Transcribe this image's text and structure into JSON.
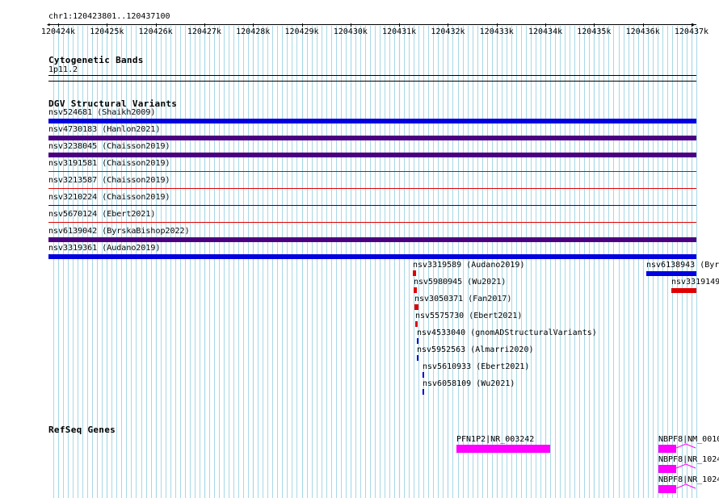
{
  "location": {
    "coord_text": "chr1:120423801..120437100",
    "start": 120423801,
    "end": 120437100,
    "tick_labels": [
      "120424k",
      "120425k",
      "120426k",
      "120427k",
      "120428k",
      "120429k",
      "120430k",
      "120431k",
      "120432k",
      "120433k",
      "120434k",
      "120435k",
      "120436k",
      "120437k"
    ],
    "tick_positions_bp": [
      120424000,
      120425000,
      120426000,
      120427000,
      120428000,
      120429000,
      120430000,
      120431000,
      120432000,
      120433000,
      120434000,
      120435000,
      120436000,
      120437000
    ]
  },
  "colors": {
    "grid": "#a8d8e6",
    "blue": "#0000e0",
    "purple": "#4b0082",
    "red": "#e00000",
    "gene": "#ff00ff"
  },
  "tracks": {
    "cytoband": {
      "title": "Cytogenetic Bands",
      "band_label": "1p11.2"
    },
    "dgv": {
      "title": "DGV Structural Variants",
      "rows": [
        {
          "label": "nsv524681 (Shaikh2009)",
          "color_key": "blue",
          "style": "thick"
        },
        {
          "label": "nsv4730183 (Hanlon2021)",
          "color_key": "purple",
          "style": "thick"
        },
        {
          "label": "nsv3238045 (Chaisson2019)",
          "color_key": "purple",
          "style": "thick"
        },
        {
          "label": "nsv3191581 (Chaisson2019)",
          "color_key": "red",
          "style": "thin"
        },
        {
          "label": "nsv3213587 (Chaisson2019)",
          "color_key": "red",
          "style": "thin"
        },
        {
          "label": "nsv3210224 (Chaisson2019)",
          "color_key": "blue",
          "style": "thin"
        },
        {
          "label": "nsv5670124 (Ebert2021)",
          "color_key": "red",
          "style": "thin"
        },
        {
          "label": "nsv6139042 (ByrskaBishop2022)",
          "color_key": "purple",
          "style": "thick"
        },
        {
          "label": "nsv3319361 (Audano2019)",
          "color_key": "blue",
          "style": "thick"
        }
      ],
      "small_features": [
        {
          "label": "nsv3319589 (Audano2019)",
          "color_key": "red"
        },
        {
          "label": "nsv5980945 (Wu2021)",
          "color_key": "red"
        },
        {
          "label": "nsv3050371 (Fan2017)",
          "color_key": "red"
        },
        {
          "label": "nsv5575730 (Ebert2021)",
          "color_key": "red"
        },
        {
          "label": "nsv4533040 (gnomADStructuralVariants)",
          "color_key": "blue"
        },
        {
          "label": "nsv5952563 (Almarri2020)",
          "color_key": "blue"
        },
        {
          "label": "nsv5610933 (Ebert2021)",
          "color_key": "blue"
        },
        {
          "label": "nsv6058109 (Wu2021)",
          "color_key": "blue"
        }
      ],
      "right_features": [
        {
          "label": "nsv6138943 (Byr",
          "color_key": "blue"
        },
        {
          "label": "nsv3319149",
          "color_key": "red"
        }
      ]
    },
    "refseq": {
      "title": "RefSeq Genes",
      "genes": [
        {
          "label": "PFN1P2|NR_003242"
        },
        {
          "label": "NBPF8|NM_0010"
        },
        {
          "label": "NBPF8|NR_1024"
        },
        {
          "label": "NBPF8|NR_1024"
        }
      ]
    }
  }
}
